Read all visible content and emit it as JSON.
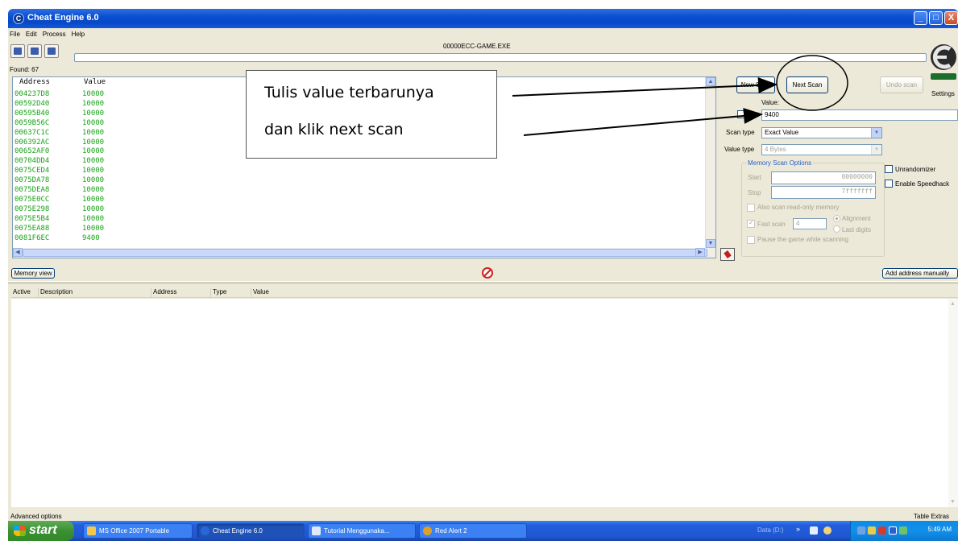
{
  "window": {
    "title": "Cheat Engine 6.0",
    "controls": [
      "_",
      "□",
      "X"
    ]
  },
  "menu": [
    "File",
    "Edit",
    "Process",
    "Help"
  ],
  "process_name": "00000ECC-GAME.EXE",
  "found_label": "Found: 67",
  "results": {
    "headers": {
      "address": "Address",
      "value": "Value"
    },
    "rows": [
      {
        "address": "004237D8",
        "value": "10000"
      },
      {
        "address": "00592D40",
        "value": "10000"
      },
      {
        "address": "00595B40",
        "value": "10000"
      },
      {
        "address": "0059B56C",
        "value": "10000"
      },
      {
        "address": "00637C1C",
        "value": "10000"
      },
      {
        "address": "006392AC",
        "value": "10000"
      },
      {
        "address": "00652AF0",
        "value": "10000"
      },
      {
        "address": "00704DD4",
        "value": "10000"
      },
      {
        "address": "0075CED4",
        "value": "10000"
      },
      {
        "address": "0075DA78",
        "value": "10000"
      },
      {
        "address": "0075DEA8",
        "value": "10000"
      },
      {
        "address": "0075E0CC",
        "value": "10000"
      },
      {
        "address": "0075E298",
        "value": "10000"
      },
      {
        "address": "0075E5B4",
        "value": "10000"
      },
      {
        "address": "0075EA88",
        "value": "10000"
      },
      {
        "address": "0081F6EC",
        "value": "9400"
      }
    ]
  },
  "annotation": {
    "line1": "Tulis value terbarunya",
    "line2": "dan klik next scan"
  },
  "scan_panel": {
    "new_scan": "New Scan",
    "next_scan": "Next Scan",
    "undo_scan": "Undo scan",
    "settings": "Settings",
    "value_label": "Value:",
    "value_input": "9400",
    "hex_label": "Hex",
    "scan_type_label": "Scan type",
    "scan_type_value": "Exact Value",
    "value_type_label": "Value type",
    "value_type_value": "4 Bytes",
    "memory_options_title": "Memory Scan Options",
    "start_label": "Start",
    "start_value": "00000000",
    "stop_label": "Stop",
    "stop_value": "7fffffff",
    "readonly_label": "Also scan read-only memory",
    "fastscan_label": "Fast scan",
    "fastscan_value": "4",
    "alignment_label": "Alignment",
    "lastdigits_label": "Last digits",
    "pause_label": "Pause the game while scanning",
    "unrandomizer_label": "Unrandomizer",
    "speedhack_label": "Enable Speedhack"
  },
  "memory_view": "Memory view",
  "add_address": "Add address manually",
  "address_table": {
    "headers": [
      "Active",
      "Description",
      "Address",
      "Type",
      "Value"
    ]
  },
  "advanced_options": "Advanced options",
  "table_extras": "Table Extras",
  "taskbar": {
    "start": "start",
    "tasks": [
      "MS Office 2007 Portable",
      "Cheat Engine 6.0",
      "Tutorial Menggunaka...",
      "Red Alert 2"
    ],
    "drive": "Data (D:)",
    "clock": "5:49 AM"
  }
}
